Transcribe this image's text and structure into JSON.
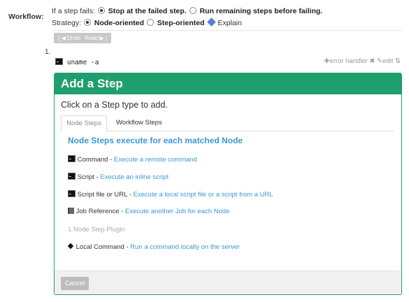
{
  "workflow": {
    "label": "Workflow:",
    "if_fail_label": "If a step fails:",
    "option_stop": "Stop at the failed step.",
    "option_run_remaining": "Run remaining steps before failing.",
    "strategy_label": "Strategy:",
    "strategy_node": "Node-oriented",
    "strategy_step": "Step-oriented",
    "explain": "Explain"
  },
  "toolbar": {
    "undo": "Undo",
    "redo": "Redo"
  },
  "step": {
    "number": "1.",
    "command": "uname -a",
    "error_handler": "error handler",
    "edit": "edit"
  },
  "add_step": {
    "title": "Add a Step",
    "subtitle": "Click on a Step type to add.",
    "tabs": [
      "Node Steps",
      "Workflow Steps"
    ],
    "section_title": "Node Steps execute for each matched Node",
    "items": [
      {
        "name": "Command",
        "desc": "Execute a remote command"
      },
      {
        "name": "Script",
        "desc": "Execute an inline script"
      },
      {
        "name": "Script file or URL",
        "desc": "Execute a local script file or a script from a URL"
      },
      {
        "name": "Job Reference",
        "desc": "Execute another Job for each Node"
      },
      {
        "name": "Local Command",
        "desc": "Run a command locally on the server"
      }
    ],
    "plugin_count": "1 Node Step Plugin",
    "cancel": "Cancel"
  },
  "colors": {
    "accent": "#1f9e6e",
    "link": "#3b98d4"
  }
}
